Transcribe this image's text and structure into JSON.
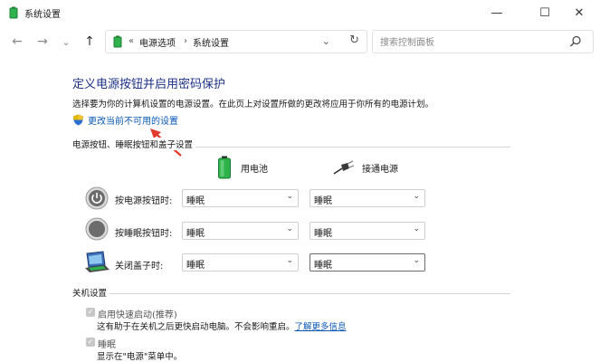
{
  "window": {
    "title": "系统设置",
    "minimize_glyph": "—",
    "maximize_glyph": "☐",
    "close_glyph": "✕"
  },
  "nav": {
    "back_glyph": "←",
    "forward_glyph": "→",
    "recent_glyph": "⌄",
    "up_glyph": "↑"
  },
  "address": {
    "overflow": "«",
    "crumbs": [
      "电源选项",
      "系统设置"
    ],
    "separator": "›",
    "dropdown_glyph": "⌄",
    "refresh_glyph": "↻"
  },
  "search": {
    "placeholder": "搜索控制面板"
  },
  "page": {
    "heading": "定义电源按钮并启用密码保护",
    "description": "选择要为你的计算机设置的电源设置。在此页上对设置所做的更改将应用于你所有的电源计划。",
    "change_link": "更改当前不可用的设置"
  },
  "power_group": {
    "title": "电源按钮、睡眠按钮和盖子设置",
    "columns": [
      "用电池",
      "接通电源"
    ],
    "rows": [
      {
        "label": "按电源按钮时:",
        "battery": "睡眠",
        "plugged": "睡眠",
        "icon": "power-button-icon"
      },
      {
        "label": "按睡眠按钮时:",
        "battery": "睡眠",
        "plugged": "睡眠",
        "icon": "sleep-button-icon"
      },
      {
        "label": "关闭盖子时:",
        "battery": "睡眠",
        "plugged": "睡眠",
        "icon": "laptop-lid-icon"
      }
    ],
    "select_chevron": "⌄"
  },
  "shutdown_group": {
    "title": "关机设置",
    "items": [
      {
        "label": "启用快速启动(推荐)",
        "checked": true,
        "desc_pre": "这有助于在关机之后更快启动电脑。不会影响重启。",
        "desc_link": "了解更多信息"
      },
      {
        "label": "睡眠",
        "checked": true,
        "desc_pre": "显示在\"电源\"菜单中。",
        "desc_link": ""
      }
    ],
    "check_glyph": "✓"
  },
  "colors": {
    "heading": "#1e3287",
    "link": "#0a57b5",
    "arrow": "#e23a2c",
    "battery": "#2fb24c"
  }
}
